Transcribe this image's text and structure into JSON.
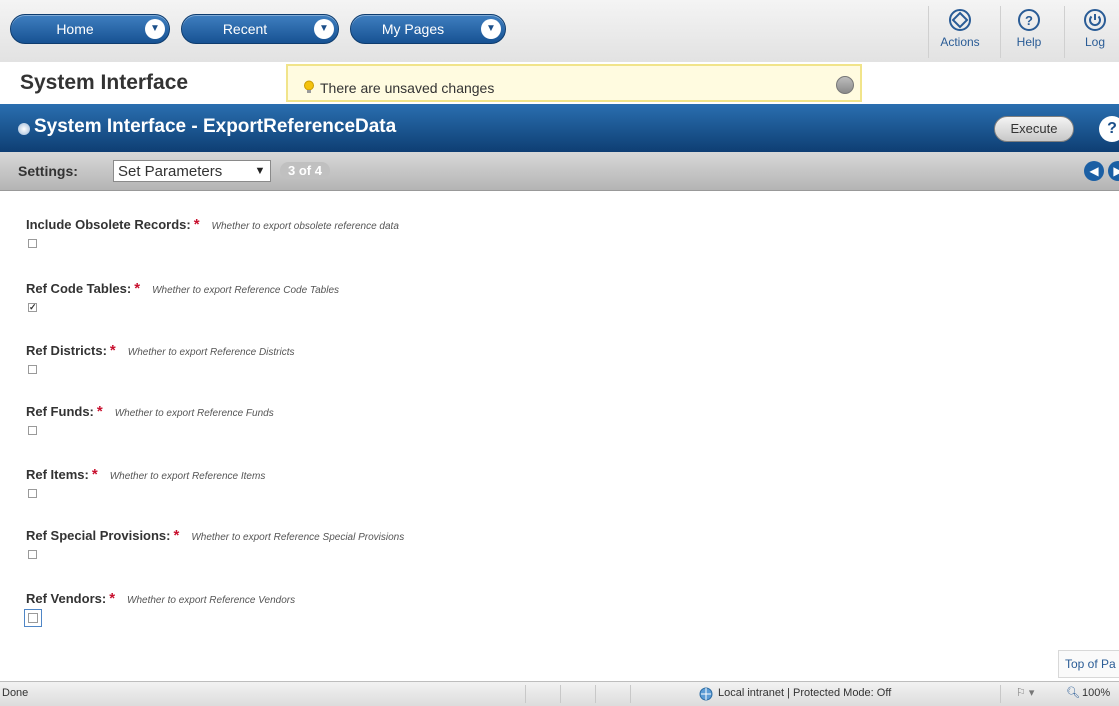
{
  "nav": {
    "home_label": "Home",
    "recent_label": "Recent",
    "mypages_label": "My Pages",
    "actions_label": "Actions",
    "help_label": "Help",
    "logout_label": "Log"
  },
  "page": {
    "app_title": "System Interface",
    "notice": "There are unsaved changes",
    "panel_title": "System Interface - ExportReferenceData",
    "execute_label": "Execute",
    "help_glyph": "?"
  },
  "settings": {
    "label": "Settings:",
    "selected": "Set Parameters",
    "page_count": "3 of 4"
  },
  "fields": [
    {
      "label": "Include Obsolete Records:",
      "required": "*",
      "help": "Whether to export obsolete reference data",
      "checked": false
    },
    {
      "label": "Ref Code Tables:",
      "required": "*",
      "help": "Whether to export Reference Code Tables",
      "checked": true
    },
    {
      "label": "Ref Districts:",
      "required": "*",
      "help": "Whether to export Reference Districts",
      "checked": false
    },
    {
      "label": "Ref Funds:",
      "required": "*",
      "help": "Whether to export Reference Funds",
      "checked": false
    },
    {
      "label": "Ref Items:",
      "required": "*",
      "help": "Whether to export Reference Items",
      "checked": false
    },
    {
      "label": "Ref Special Provisions:",
      "required": "*",
      "help": "Whether to export Reference Special Provisions",
      "checked": false
    },
    {
      "label": "Ref Vendors:",
      "required": "*",
      "help": "Whether to export Reference Vendors",
      "checked": false
    }
  ],
  "footer": {
    "top_of_page": "Top of Pa",
    "status_left": "Done",
    "zone": "Local intranet | Protected Mode: Off",
    "zoom": "100%"
  },
  "colors": {
    "brand_blue": "#175293",
    "required_red": "#c8102e",
    "notice_bg": "#fffbe0"
  }
}
